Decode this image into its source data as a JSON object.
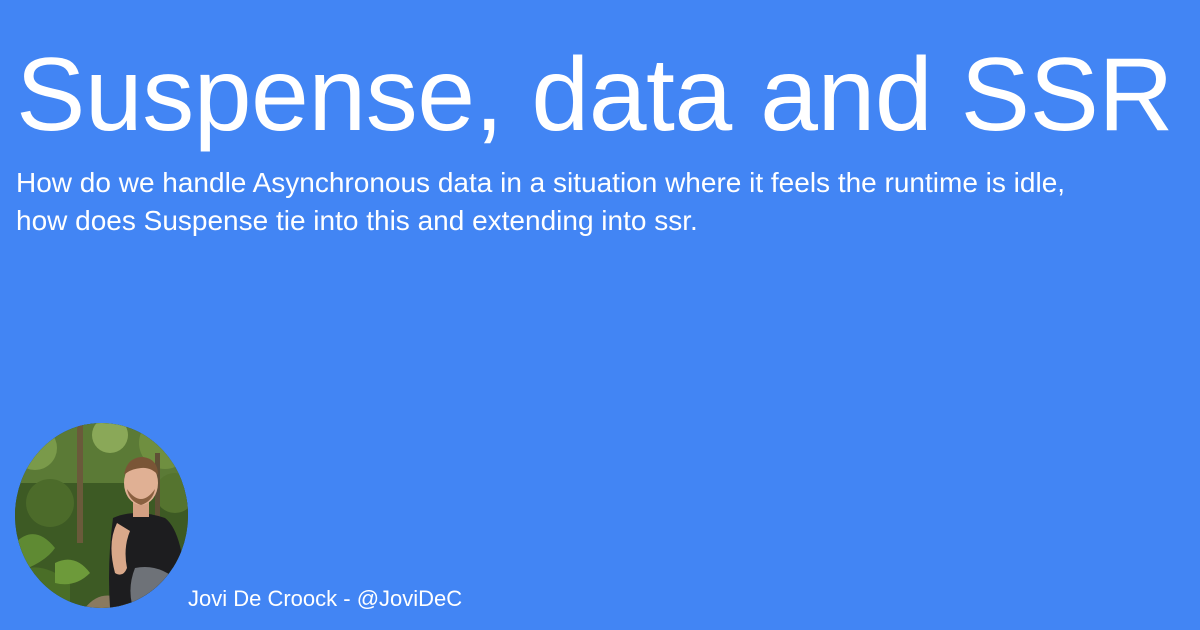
{
  "page": {
    "background_color": "#4285f4",
    "text_color": "#ffffff"
  },
  "title": "Suspense, data and SSR",
  "description": "How do we handle Asynchronous data in a situation where it feels the runtime is idle, how does Suspense tie into this and extending into ssr.",
  "author": {
    "byline": "Jovi De Croock - @JoviDeC",
    "avatar": "author-avatar-photo"
  }
}
